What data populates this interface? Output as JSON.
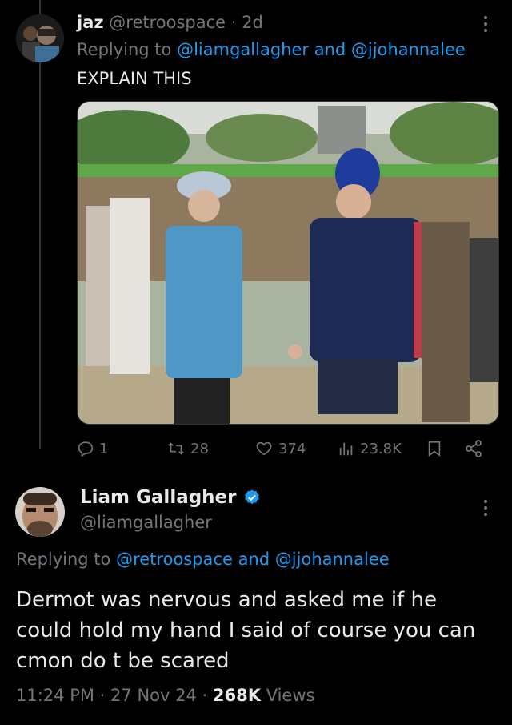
{
  "tweet1": {
    "display_name": "jaz",
    "handle": "@retroospace",
    "separator": "·",
    "age": "2d",
    "replying_prefix": "Replying to",
    "reply_user1": "@liamgallagher",
    "reply_and": "and",
    "reply_user2": "@jjohannalee",
    "text": "EXPLAIN THIS",
    "actions": {
      "replies": "1",
      "retweets": "28",
      "likes": "374",
      "views": "23.8K"
    }
  },
  "tweet2": {
    "display_name": "Liam Gallagher",
    "verified": true,
    "handle": "@liamgallagher",
    "replying_prefix": "Replying to",
    "reply_user1": "@retroospace",
    "reply_and": "and",
    "reply_user2": "@jjohannalee",
    "text": "Dermot was nervous and asked me if he could hold my hand I said of course you can cmon do t be scared",
    "time": "11:24 PM",
    "dot": "·",
    "date": "27 Nov 24",
    "dot2": "·",
    "views_count": "268K",
    "views_label": "Views"
  },
  "colors": {
    "background": "#000000",
    "text": "#e7e9ea",
    "muted": "#71767b",
    "accent": "#1d9bf0"
  },
  "icons": [
    "more-icon",
    "reply-icon",
    "retweet-icon",
    "like-icon",
    "views-icon",
    "bookmark-icon",
    "share-icon",
    "verified-badge-icon"
  ]
}
